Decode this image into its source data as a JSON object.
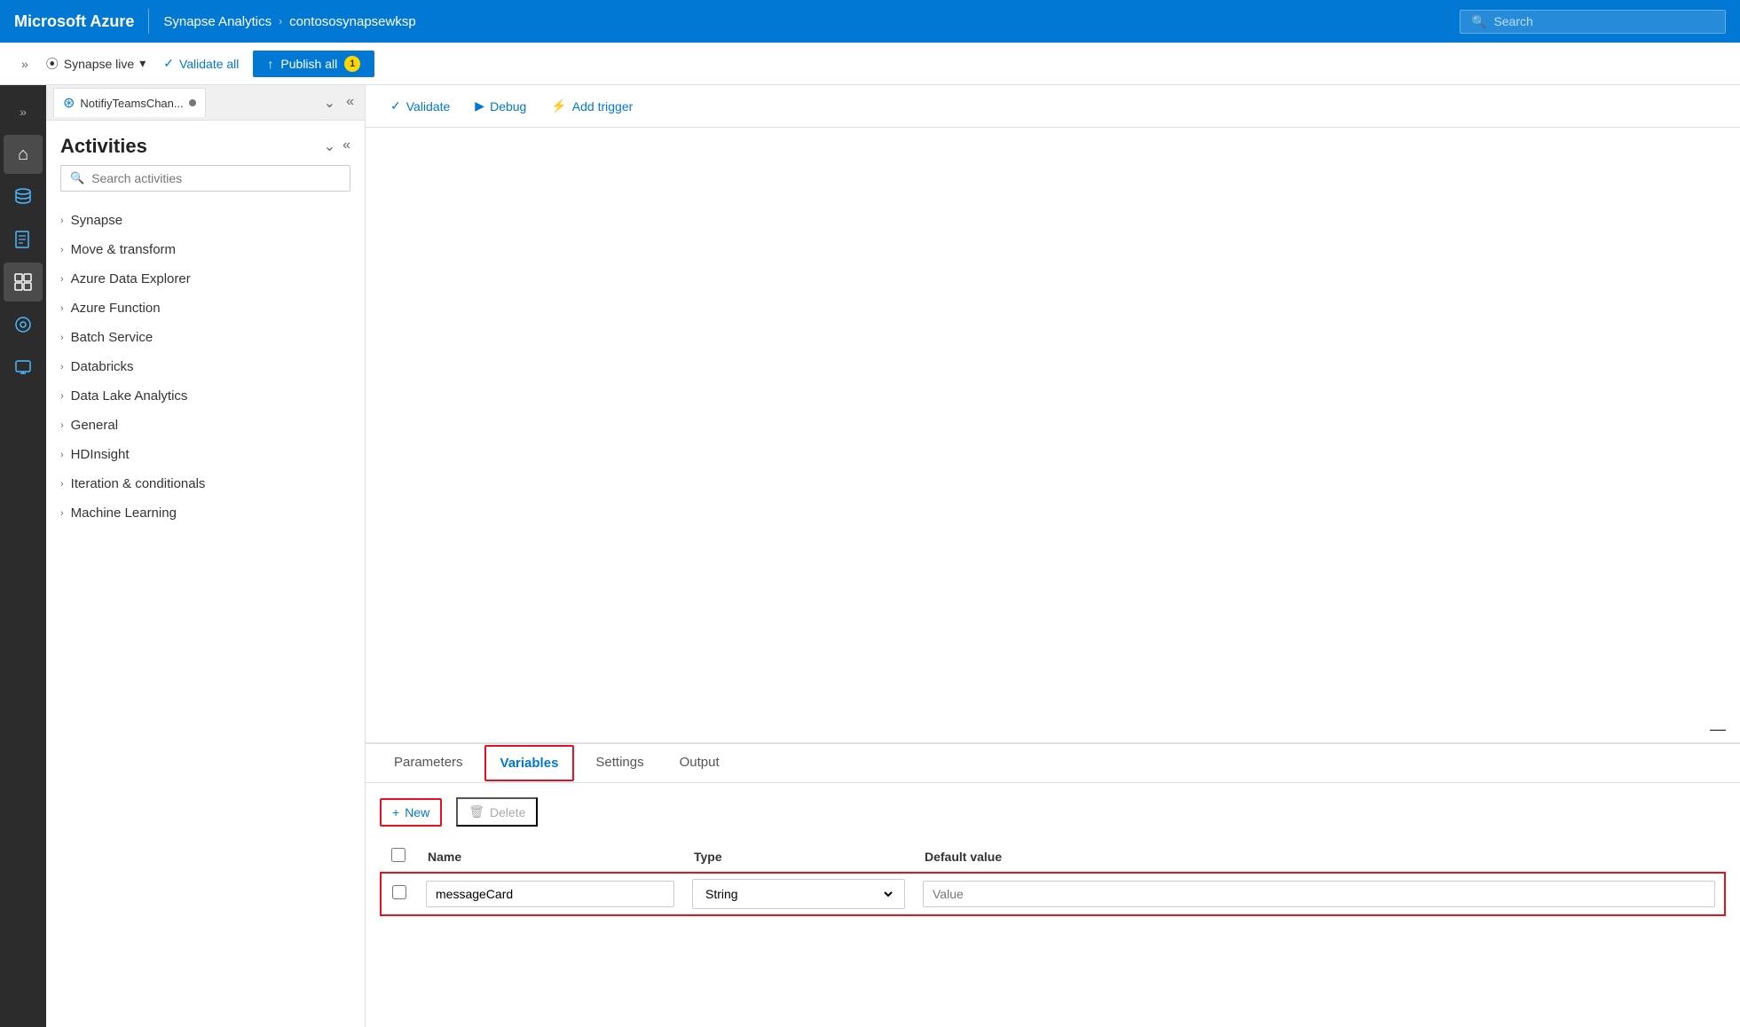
{
  "topbar": {
    "brand": "Microsoft Azure",
    "divider": "|",
    "nav_service": "Synapse Analytics",
    "nav_chevron": "›",
    "nav_workspace": "contososynapsewksp",
    "search_placeholder": "Search"
  },
  "subtoolbar": {
    "collapse_label": "»",
    "live_label": "Synapse live",
    "live_dropdown": "▾",
    "validate_label": "Validate all",
    "publish_label": "Publish all",
    "publish_badge": "1"
  },
  "sidebar": {
    "icons": [
      {
        "name": "collapse-icon",
        "symbol": "»",
        "active": false
      },
      {
        "name": "home-icon",
        "symbol": "⌂",
        "active": true
      },
      {
        "name": "database-icon",
        "symbol": "🗄",
        "active": false
      },
      {
        "name": "document-icon",
        "symbol": "📄",
        "active": false
      },
      {
        "name": "pipeline-icon",
        "symbol": "⊞",
        "active": true
      },
      {
        "name": "monitor-icon",
        "symbol": "⊙",
        "active": false
      },
      {
        "name": "briefcase-icon",
        "symbol": "🎒",
        "active": false
      }
    ]
  },
  "panel": {
    "tab_label": "NotifiyTeamsChan...",
    "tab_dot": true,
    "collapse_controls": [
      "⌄",
      "«"
    ]
  },
  "activities": {
    "title": "Activities",
    "search_placeholder": "Search activities",
    "categories": [
      {
        "label": "Synapse"
      },
      {
        "label": "Move & transform"
      },
      {
        "label": "Azure Data Explorer"
      },
      {
        "label": "Azure Function"
      },
      {
        "label": "Batch Service"
      },
      {
        "label": "Databricks"
      },
      {
        "label": "Data Lake Analytics"
      },
      {
        "label": "General"
      },
      {
        "label": "HDInsight"
      },
      {
        "label": "Iteration & conditionals"
      },
      {
        "label": "Machine Learning"
      }
    ]
  },
  "content_toolbar": {
    "validate_label": "Validate",
    "debug_label": "Debug",
    "trigger_label": "Add trigger"
  },
  "bottom_panel": {
    "tabs": [
      {
        "label": "Parameters",
        "active": false
      },
      {
        "label": "Variables",
        "active": true
      },
      {
        "label": "Settings",
        "active": false
      },
      {
        "label": "Output",
        "active": false
      }
    ],
    "new_btn": "New",
    "delete_btn": "Delete",
    "table": {
      "headers": [
        "",
        "Name",
        "Type",
        "Default value"
      ],
      "rows": [
        {
          "checked": false,
          "name": "messageCard",
          "type": "String",
          "default_value": "Value"
        }
      ]
    }
  }
}
